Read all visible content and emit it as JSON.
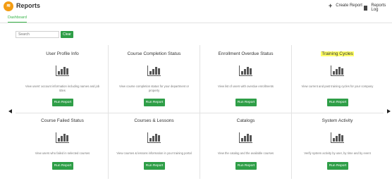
{
  "header": {
    "title": "Reports",
    "create_label": "Create Report",
    "log_label": "Reports Log"
  },
  "tabs": [
    {
      "label": "Dashboard"
    }
  ],
  "search": {
    "placeholder": "Search",
    "clear_label": "Clear"
  },
  "cards": [
    {
      "title": "User Profile Info",
      "description": "View users' account information including names and job titles",
      "button": "Run Report"
    },
    {
      "title": "Course Completion Status",
      "description": "View course completion status for your department or property",
      "button": "Run Report"
    },
    {
      "title": "Enrollment Overdue Status",
      "description": "View list of users with overdue enrollments",
      "button": "Run Report"
    },
    {
      "title": "Training Cycles",
      "description": "View current and past training cycles for your company",
      "button": "Run Report"
    },
    {
      "title": "Course Failed Status",
      "description": "View users who failed in selected courses",
      "button": "Run Report"
    },
    {
      "title": "Courses & Lessons",
      "description": "View courses & lessons information in your training portal",
      "button": "Run Report"
    },
    {
      "title": "Catalogs",
      "description": "View the catalog and the available courses",
      "button": "Run Report"
    },
    {
      "title": "System Activity",
      "description": "Verify system activity by user, by time and by event",
      "button": "Run Report"
    }
  ],
  "icons": {
    "logo": "reports-app-logo",
    "create": "plus-icon",
    "log": "document-icon",
    "card": "bar-chart-icon",
    "prev": "chevron-left-icon",
    "next": "chevron-right-icon"
  },
  "colors": {
    "accent_green": "#2e9e47",
    "logo_orange": "#f39c12",
    "highlight": "#ffff66"
  }
}
